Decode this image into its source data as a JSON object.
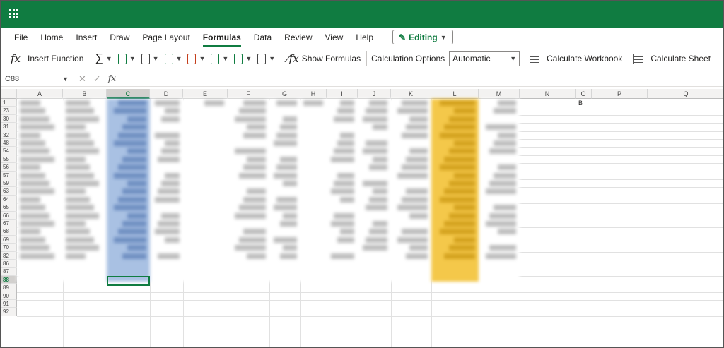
{
  "titlebar": {
    "color": "#107c41",
    "icon": "waffle-icon"
  },
  "tabs": [
    {
      "label": "File"
    },
    {
      "label": "Home"
    },
    {
      "label": "Insert"
    },
    {
      "label": "Draw"
    },
    {
      "label": "Page Layout"
    },
    {
      "label": "Formulas",
      "active": true
    },
    {
      "label": "Data"
    },
    {
      "label": "Review"
    },
    {
      "label": "View"
    },
    {
      "label": "Help"
    }
  ],
  "editing": {
    "label": "Editing",
    "icon": "pencil-icon"
  },
  "toolbar": {
    "insert_function": "Insert Function",
    "show_formulas": "Show Formulas",
    "calc_options_label": "Calculation Options",
    "calc_options_value": "Automatic",
    "calc_workbook": "Calculate Workbook",
    "calc_sheet": "Calculate Sheet"
  },
  "formula_bar": {
    "name_box": "C88",
    "fx": "fx",
    "value": ""
  },
  "grid": {
    "columns": [
      "A",
      "B",
      "C",
      "D",
      "E",
      "F",
      "G",
      "H",
      "I",
      "J",
      "K",
      "L",
      "M",
      "N",
      "O",
      "P",
      "Q"
    ],
    "selected_column": "C",
    "rows": [
      "1",
      "23",
      "30",
      "31",
      "32",
      "48",
      "54",
      "55",
      "56",
      "57",
      "59",
      "63",
      "64",
      "65",
      "66",
      "67",
      "68",
      "69",
      "70",
      "82",
      "86",
      "87",
      "88",
      "89",
      "90",
      "91",
      "92"
    ],
    "selected_row": "88",
    "cell_O1": "B",
    "highlight_colors": {
      "column_c": "#a9c1e3",
      "column_l": "#f4c84a"
    }
  }
}
